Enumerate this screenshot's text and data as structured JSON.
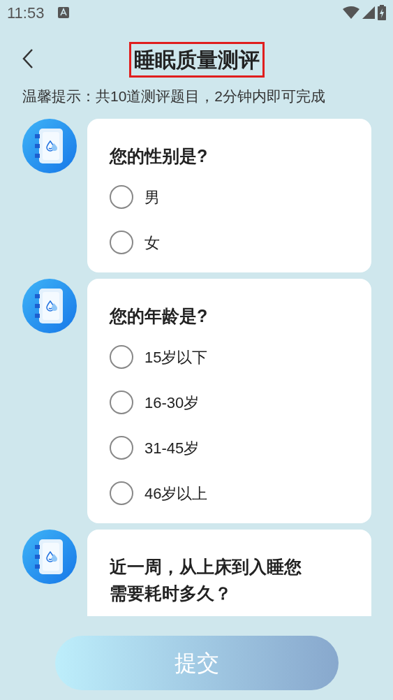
{
  "status_bar": {
    "time": "11:53"
  },
  "header": {
    "title": "睡眠质量测评",
    "highlighted": true
  },
  "hint": "温馨提示：共10道测评题目，2分钟内即可完成",
  "questions": [
    {
      "text": "您的性别是?",
      "options": [
        {
          "label": "男",
          "selected": false
        },
        {
          "label": "女",
          "selected": false
        }
      ]
    },
    {
      "text": "您的年龄是?",
      "options": [
        {
          "label": "15岁以下",
          "selected": false
        },
        {
          "label": "16-30岁",
          "selected": false
        },
        {
          "label": "31-45岁",
          "selected": false
        },
        {
          "label": "46岁以上",
          "selected": false
        }
      ]
    },
    {
      "text": "近一周，从上床到入睡您需要耗时多久？"
    }
  ],
  "submit": {
    "label": "提交",
    "disabled": true
  }
}
